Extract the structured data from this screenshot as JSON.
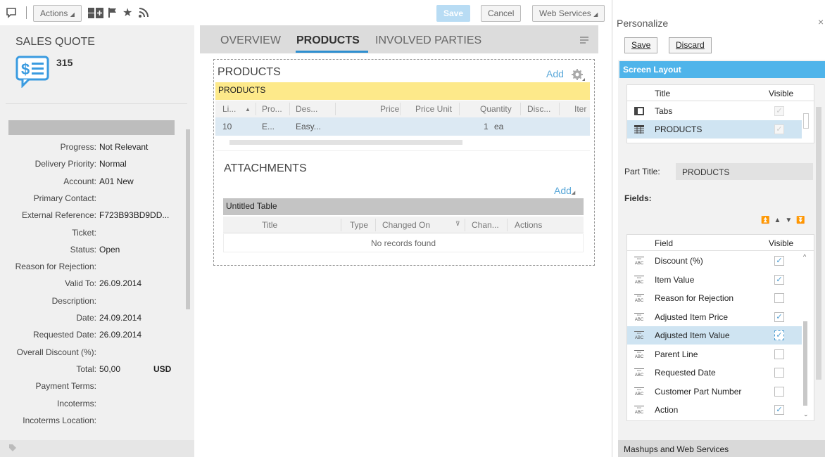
{
  "toolbar": {
    "actions_label": "Actions",
    "save_label": "Save",
    "cancel_label": "Cancel",
    "web_services_label": "Web Services"
  },
  "header": {
    "object_type": "SALES QUOTE",
    "object_id": "315"
  },
  "fields": [
    {
      "label": "Progress:",
      "value": "Not Relevant"
    },
    {
      "label": "Delivery Priority:",
      "value": "Normal"
    },
    {
      "label": "Account:",
      "value": "A01 New"
    },
    {
      "label": "Primary Contact:",
      "value": ""
    },
    {
      "label": "External Reference:",
      "value": "F723B93BD9DD..."
    },
    {
      "label": "Ticket:",
      "value": ""
    },
    {
      "label": "Status:",
      "value": "Open"
    },
    {
      "label": "Reason for Rejection:",
      "value": ""
    },
    {
      "label": "Valid To:",
      "value": "26.09.2014"
    },
    {
      "label": "Description:",
      "value": ""
    },
    {
      "label": "Date:",
      "value": "24.09.2014"
    },
    {
      "label": "Requested Date:",
      "value": "26.09.2014"
    },
    {
      "label": "Overall Discount (%):",
      "value": ""
    },
    {
      "label": "Total:",
      "value": "50,00",
      "extra": "USD"
    },
    {
      "label": "Payment Terms:",
      "value": ""
    },
    {
      "label": "Incoterms:",
      "value": ""
    },
    {
      "label": "Incoterms Location:",
      "value": ""
    }
  ],
  "tabs": [
    {
      "label": "OVERVIEW",
      "active": false
    },
    {
      "label": "PRODUCTS",
      "active": true
    },
    {
      "label": "INVOLVED PARTIES",
      "active": false
    }
  ],
  "products": {
    "title": "PRODUCTS",
    "add_label": "Add",
    "bar_label": "PRODUCTS",
    "columns": [
      "Li...",
      "Pro...",
      "Des...",
      "Price",
      "Price Unit",
      "Quantity",
      "Disc...",
      "Iter"
    ],
    "row": [
      "10",
      "E...",
      "Easy...",
      "",
      "",
      "1",
      "ea",
      ""
    ]
  },
  "attachments": {
    "title": "ATTACHMENTS",
    "add_label": "Add",
    "table_title": "Untitled Table",
    "columns": [
      "Title",
      "Type",
      "Changed On",
      "Chan...",
      "Actions"
    ],
    "empty_text": "No records found"
  },
  "personalize": {
    "title": "Personalize",
    "close": "×",
    "save_label": "Save",
    "discard_label": "Discard",
    "screen_layout_label": "Screen Layout",
    "layout_columns": [
      "Title",
      "Visible"
    ],
    "layout_rows": [
      {
        "title": "Tabs",
        "visible": true,
        "selected": false
      },
      {
        "title": "PRODUCTS",
        "visible": true,
        "selected": true
      }
    ],
    "part_title_label": "Part Title:",
    "part_title_value": "PRODUCTS",
    "fields_label": "Fields:",
    "field_columns": [
      "Field",
      "Visible"
    ],
    "field_rows": [
      {
        "name": "Discount (%)",
        "visible": true,
        "selected": false
      },
      {
        "name": "Item Value",
        "visible": true,
        "selected": false
      },
      {
        "name": "Reason for Rejection",
        "visible": false,
        "selected": false
      },
      {
        "name": "Adjusted Item Price",
        "visible": true,
        "selected": false
      },
      {
        "name": "Adjusted Item Value",
        "visible": true,
        "selected": true
      },
      {
        "name": "Parent Line",
        "visible": false,
        "selected": false
      },
      {
        "name": "Requested Date",
        "visible": false,
        "selected": false
      },
      {
        "name": "Customer Part Number",
        "visible": false,
        "selected": false
      },
      {
        "name": "Action",
        "visible": true,
        "selected": false
      }
    ],
    "mashups_label": "Mashups and Web Services"
  },
  "colors": {
    "accent": "#2e8fd0",
    "header_blue": "#4fb4ea",
    "yellow": "#fde98a"
  }
}
